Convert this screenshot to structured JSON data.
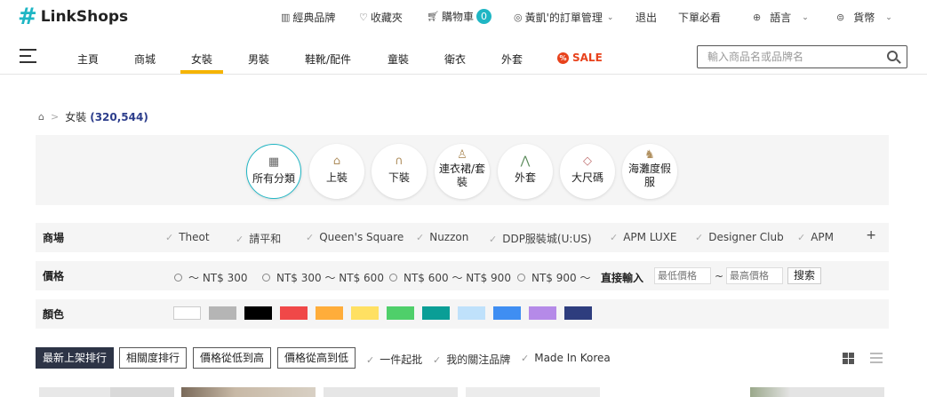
{
  "brand": {
    "logo_symbol": "#",
    "name": "LinkShops",
    "accent": "#1fb6c4"
  },
  "top_nav": [
    {
      "icon": "brand-icon",
      "label": "經典品牌"
    },
    {
      "icon": "heart-icon",
      "label": "收藏夾"
    },
    {
      "icon": "cart-icon",
      "label": "購物車",
      "badge": "0"
    },
    {
      "icon": "user-icon",
      "label": "黃凱'的訂單管理",
      "dropdown": true
    },
    {
      "label": "退出"
    },
    {
      "label": "下單必看"
    },
    {
      "icon": "globe-icon",
      "label": "語言",
      "dropdown": true
    },
    {
      "icon": "currency-icon",
      "label": "貨幣",
      "dropdown": true
    }
  ],
  "main_nav": {
    "items": [
      "主頁",
      "商城",
      "女裝",
      "男裝",
      "鞋靴/配件",
      "童裝",
      "衛衣",
      "外套"
    ],
    "active": "女裝",
    "sale_label": "SALE",
    "active_color": "#f5b400",
    "sale_color": "#e8421c"
  },
  "search": {
    "placeholder": "輸入商品名或品牌名"
  },
  "breadcrumb": {
    "current": "女裝",
    "count": "(320,544)"
  },
  "categories": [
    {
      "icon": "grid-icon",
      "label": "所有分類",
      "active": true
    },
    {
      "icon": "shirt-icon",
      "label": "上裝"
    },
    {
      "icon": "pants-icon",
      "label": "下裝"
    },
    {
      "icon": "dress-icon",
      "label": "連衣裙/套裝"
    },
    {
      "icon": "jacket-icon",
      "label": "外套"
    },
    {
      "icon": "tag-icon",
      "label": "大尺碼"
    },
    {
      "icon": "bunny-icon",
      "label": "海灘度假服"
    }
  ],
  "filters": {
    "mall": {
      "label": "商場",
      "options": [
        "Theot",
        "請平和",
        "Queen's Square",
        "Nuzzon",
        "DDP服裝城(U:US)",
        "APM LUXE",
        "Designer Club",
        "APM"
      ],
      "more": "+"
    },
    "price": {
      "label": "價格",
      "options": [
        "～ NT$ 300",
        "NT$ 300 ～ NT$ 600",
        "NT$ 600 ～ NT$ 900",
        "NT$ 900 ～"
      ],
      "direct_label": "直接輸入",
      "min_placeholder": "最低價格",
      "tilde": "~",
      "max_placeholder": "最高價格",
      "search_button": "搜索"
    },
    "color": {
      "label": "顏色",
      "swatches": [
        "#ffffff",
        "#b5b5b5",
        "#000000",
        "#f04848",
        "#ffad3a",
        "#ffe062",
        "#4fcf6a",
        "#0a9e96",
        "#bfe1fb",
        "#3f8ef2",
        "#b58ae8",
        "#2e3d7e"
      ]
    }
  },
  "sort": {
    "options": [
      "最新上架排行",
      "相關度排行",
      "價格從低到高",
      "價格從高到低"
    ],
    "active": "最新上架排行",
    "toggles": [
      "一件起批",
      "我的關注品牌",
      "Made In Korea"
    ]
  }
}
